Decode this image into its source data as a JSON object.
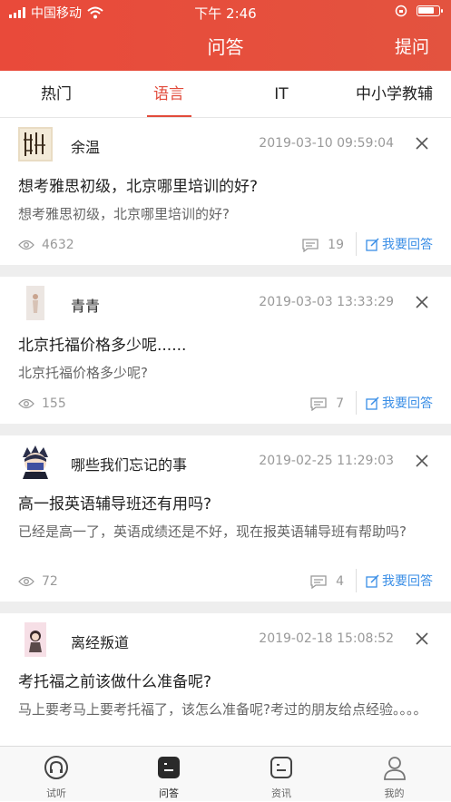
{
  "status_bar": {
    "carrier": "中国移动",
    "time": "下午 2:46"
  },
  "nav": {
    "title": "问答",
    "action": "提问"
  },
  "tabs": [
    {
      "label": "热门",
      "active": false
    },
    {
      "label": "语言",
      "active": true
    },
    {
      "label": "IT",
      "active": false
    },
    {
      "label": "中小学教辅",
      "active": false
    }
  ],
  "colors": {
    "brand": "#e94a3a",
    "link": "#3a8ee6",
    "muted": "#999999"
  },
  "questions": [
    {
      "author": "余温",
      "date": "2019-03-10 09:59:04",
      "title": "想考雅思初级，北京哪里培训的好?",
      "description": "想考雅思初级，北京哪里培训的好?",
      "views": "4632",
      "comments": "19",
      "answer_label": "我要回答",
      "avatar_icon": "calligraphy-avatar"
    },
    {
      "author": "青青",
      "date": "2019-03-03 13:33:29",
      "title": "北京托福价格多少呢......",
      "description": "北京托福价格多少呢?",
      "views": "155",
      "comments": "7",
      "answer_label": "我要回答",
      "avatar_icon": "figure-avatar"
    },
    {
      "author": "哪些我们忘记的事",
      "date": "2019-02-25 11:29:03",
      "title": "高一报英语辅导班还有用吗?",
      "description": "已经是高一了，英语成绩还是不好，现在报英语辅导班有帮助吗?",
      "views": "72",
      "comments": "4",
      "answer_label": "我要回答",
      "avatar_icon": "cartoon-avatar"
    },
    {
      "author": "离经叛道",
      "date": "2019-02-18 15:08:52",
      "title": "考托福之前该做什么准备呢?",
      "description": "马上要考马上要考托福了，该怎么准备呢?考过的朋友给点经验。。。。",
      "avatar_icon": "doll-avatar"
    }
  ],
  "tabbar": [
    {
      "label": "试听",
      "icon": "headphones-icon",
      "active": false
    },
    {
      "label": "问答",
      "icon": "chat-icon",
      "active": true
    },
    {
      "label": "资讯",
      "icon": "news-icon",
      "active": false
    },
    {
      "label": "我的",
      "icon": "person-icon",
      "active": false
    }
  ]
}
